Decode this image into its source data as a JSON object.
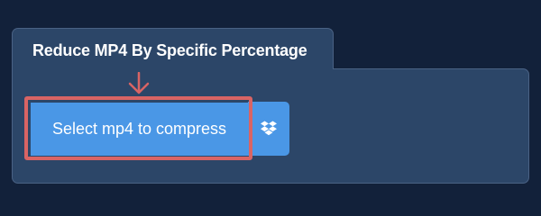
{
  "tab": {
    "title": "Reduce MP4 By Specific Percentage"
  },
  "upload": {
    "select_label": "Select mp4 to compress",
    "dropbox_icon": "dropbox-icon",
    "indicator_icon": "down-arrow-icon"
  },
  "colors": {
    "background": "#12213a",
    "panel": "#2c4668",
    "button": "#4a97e6",
    "highlight": "#d96464"
  }
}
